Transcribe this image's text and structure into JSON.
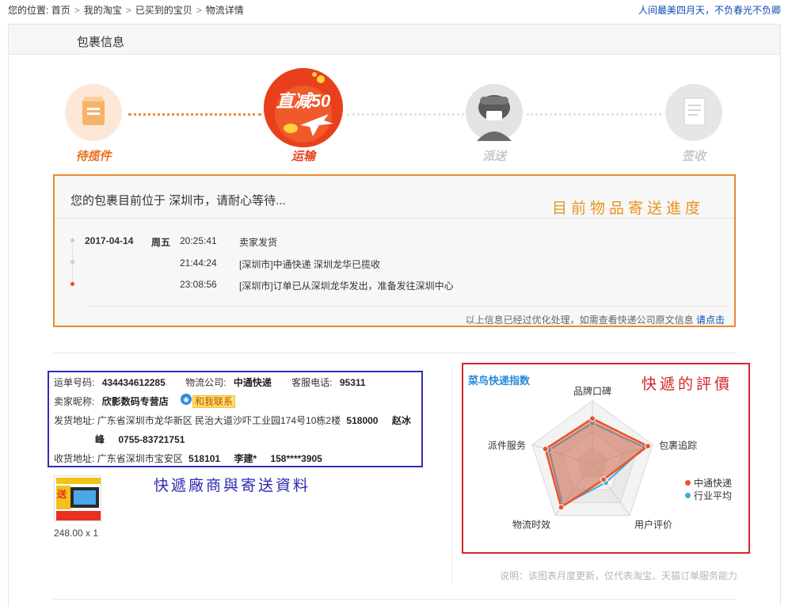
{
  "breadcrumb": {
    "prefix": "您的位置:",
    "items": [
      "首页",
      "我的淘宝",
      "已买到的宝贝",
      "物流详情"
    ],
    "separator": ">"
  },
  "promo_link": "人间最美四月天，不负春光不负卿",
  "panel_title": "包裹信息",
  "steps": [
    {
      "label": "待揽件",
      "state": "done"
    },
    {
      "label": "运输",
      "state": "current",
      "badge": "直减50"
    },
    {
      "label": "派送",
      "state": "pending"
    },
    {
      "label": "签收",
      "state": "pending"
    }
  ],
  "tracking": {
    "header": "您的包裹目前位于 深圳市，请耐心等待...",
    "annotation": "目前物品寄送進度",
    "events": [
      {
        "date": "2017-04-14",
        "weekday": "周五",
        "time": "20:25:41",
        "desc": "卖家发货"
      },
      {
        "date": "",
        "weekday": "",
        "time": "21:44:24",
        "desc": "[深圳市]中通快递 深圳龙华已揽收"
      },
      {
        "date": "",
        "weekday": "",
        "time": "23:08:56",
        "desc": "[深圳市]订单已从深圳龙华发出，准备发往深圳中心"
      }
    ],
    "footer_text": "以上信息已经过优化处理，如需查看快递公司原文信息",
    "footer_link": "请点击"
  },
  "shipment": {
    "waybill_label": "运单号码:",
    "waybill": "434434612285",
    "carrier_label": "物流公司:",
    "carrier": "中通快递",
    "phone_label": "客服电话:",
    "phone": "95311",
    "seller_label": "卖家昵称:",
    "seller": "欣影数码专营店",
    "contact_label": "和我联系",
    "ship_from_label": "发货地址:",
    "ship_from_addr": "广东省深圳市龙华新区 民治大道沙吓工业园174号10栋2楼",
    "ship_from_zip": "518000",
    "ship_from_name_1": "赵冰",
    "ship_from_name_2": "峰",
    "ship_from_phone": "0755-83721751",
    "ship_to_label": "收货地址:",
    "ship_to_addr": "广东省深圳市宝安区",
    "ship_to_zip": "518101",
    "ship_to_name": "李建*",
    "ship_to_phone": "158****3905"
  },
  "info_annotation": "快遞廠商與寄送資料",
  "product": {
    "price_qty": "248.00 x 1",
    "thumb_text": "送"
  },
  "rating": {
    "logo": "菜鸟快递指数",
    "annotation": "快遞的評價",
    "axes": [
      "品牌口碑",
      "包裹追踪",
      "用户评价",
      "物流时效",
      "派件服务"
    ],
    "series": [
      {
        "name": "中通快递",
        "color": "#e8552d",
        "values": [
          0.72,
          0.92,
          0.3,
          0.84,
          0.78
        ]
      },
      {
        "name": "行业平均",
        "color": "#3aacd8",
        "values": [
          0.65,
          0.86,
          0.36,
          0.8,
          0.72
        ]
      }
    ],
    "note": "说明：该图表月度更新，仅代表淘宝、天猫订单服务能力"
  },
  "colors": {
    "accent_orange": "#e8882e",
    "link_blue": "#0a4bb0",
    "current_step": "#e8401c"
  }
}
